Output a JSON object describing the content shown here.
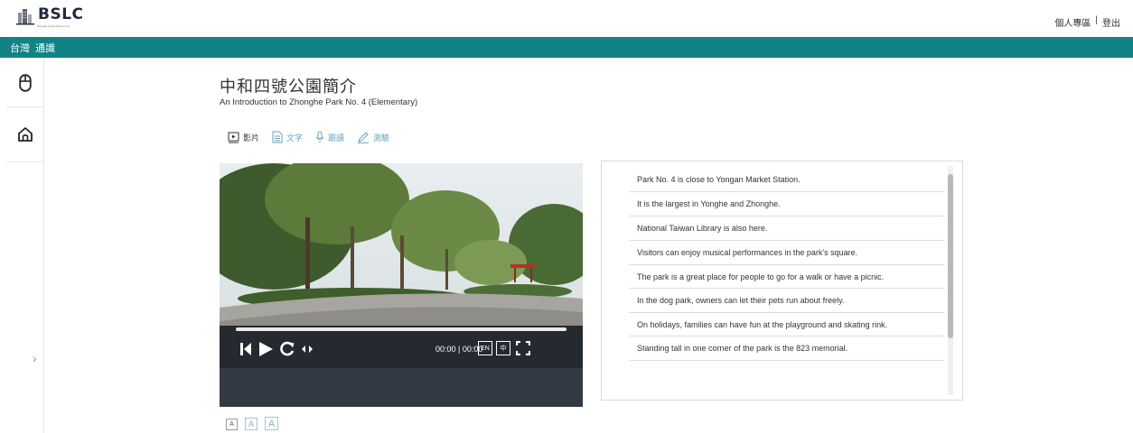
{
  "header": {
    "logo_text": "BSLC",
    "logo_subtitle": "bilingual smart learning city",
    "personal_area": "個人專區",
    "separator": "|",
    "logout": "登出"
  },
  "nav": {
    "items": [
      "台灣",
      "通識"
    ]
  },
  "lesson": {
    "title": "中和四號公園簡介",
    "subtitle": "An Introduction to Zhonghe Park No. 4 (Elementary)"
  },
  "modes": [
    {
      "label": "影片",
      "icon": "video-icon",
      "active": true
    },
    {
      "label": "文字",
      "icon": "document-icon",
      "active": false
    },
    {
      "label": "跟讀",
      "icon": "microphone-icon",
      "active": false
    },
    {
      "label": "測驗",
      "icon": "pencil-icon",
      "active": false
    }
  ],
  "player": {
    "time": "00:00 | 00:00",
    "lang_en": "EN",
    "lang_zh": "中",
    "progress": 0
  },
  "sentences": [
    "Park No. 4 is close to Yongan Market Station.",
    "It is the largest in Yonghe and Zhonghe.",
    "National Taiwan Library is also here.",
    "Visitors can enjoy musical performances in the park's square.",
    "The park is a great place for people to go for a walk or have a picnic.",
    "In the dog park, owners can let their pets run about freely.",
    "On holidays, families can have fun at the playground and skating rink.",
    "Standing tall in one corner of the park is the 823 memorial."
  ],
  "font_size_buttons": [
    "A",
    "A",
    "A"
  ],
  "colors": {
    "nav_bg": "#118386",
    "inactive_mode": "#6aa3bb",
    "player_bg": "#333a43"
  }
}
